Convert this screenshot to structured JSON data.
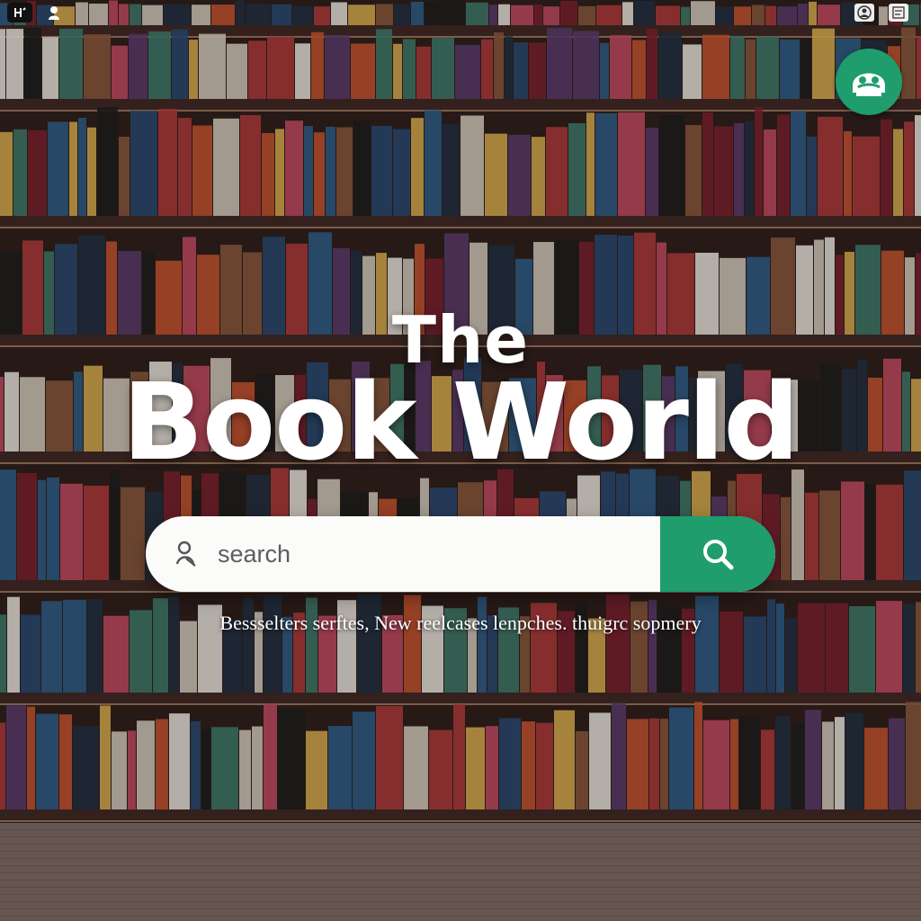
{
  "header": {
    "title_line1": "The",
    "title_line2": "Book World"
  },
  "search": {
    "placeholder": "search"
  },
  "tagline": "Bessselters serftes, New reelcases lenpches. thuigrc sopmery",
  "icons": {
    "top_left": [
      "window-icon",
      "user-icon"
    ],
    "top_right": [
      "account-icon",
      "menu-icon"
    ],
    "avatar": "mascot-icon",
    "search_lead": "person-search-icon",
    "search_button": "magnifier-icon"
  },
  "colors": {
    "accent": "#1f9d6c",
    "title": "#ffffff",
    "search_bg": "#fbfbfa"
  }
}
